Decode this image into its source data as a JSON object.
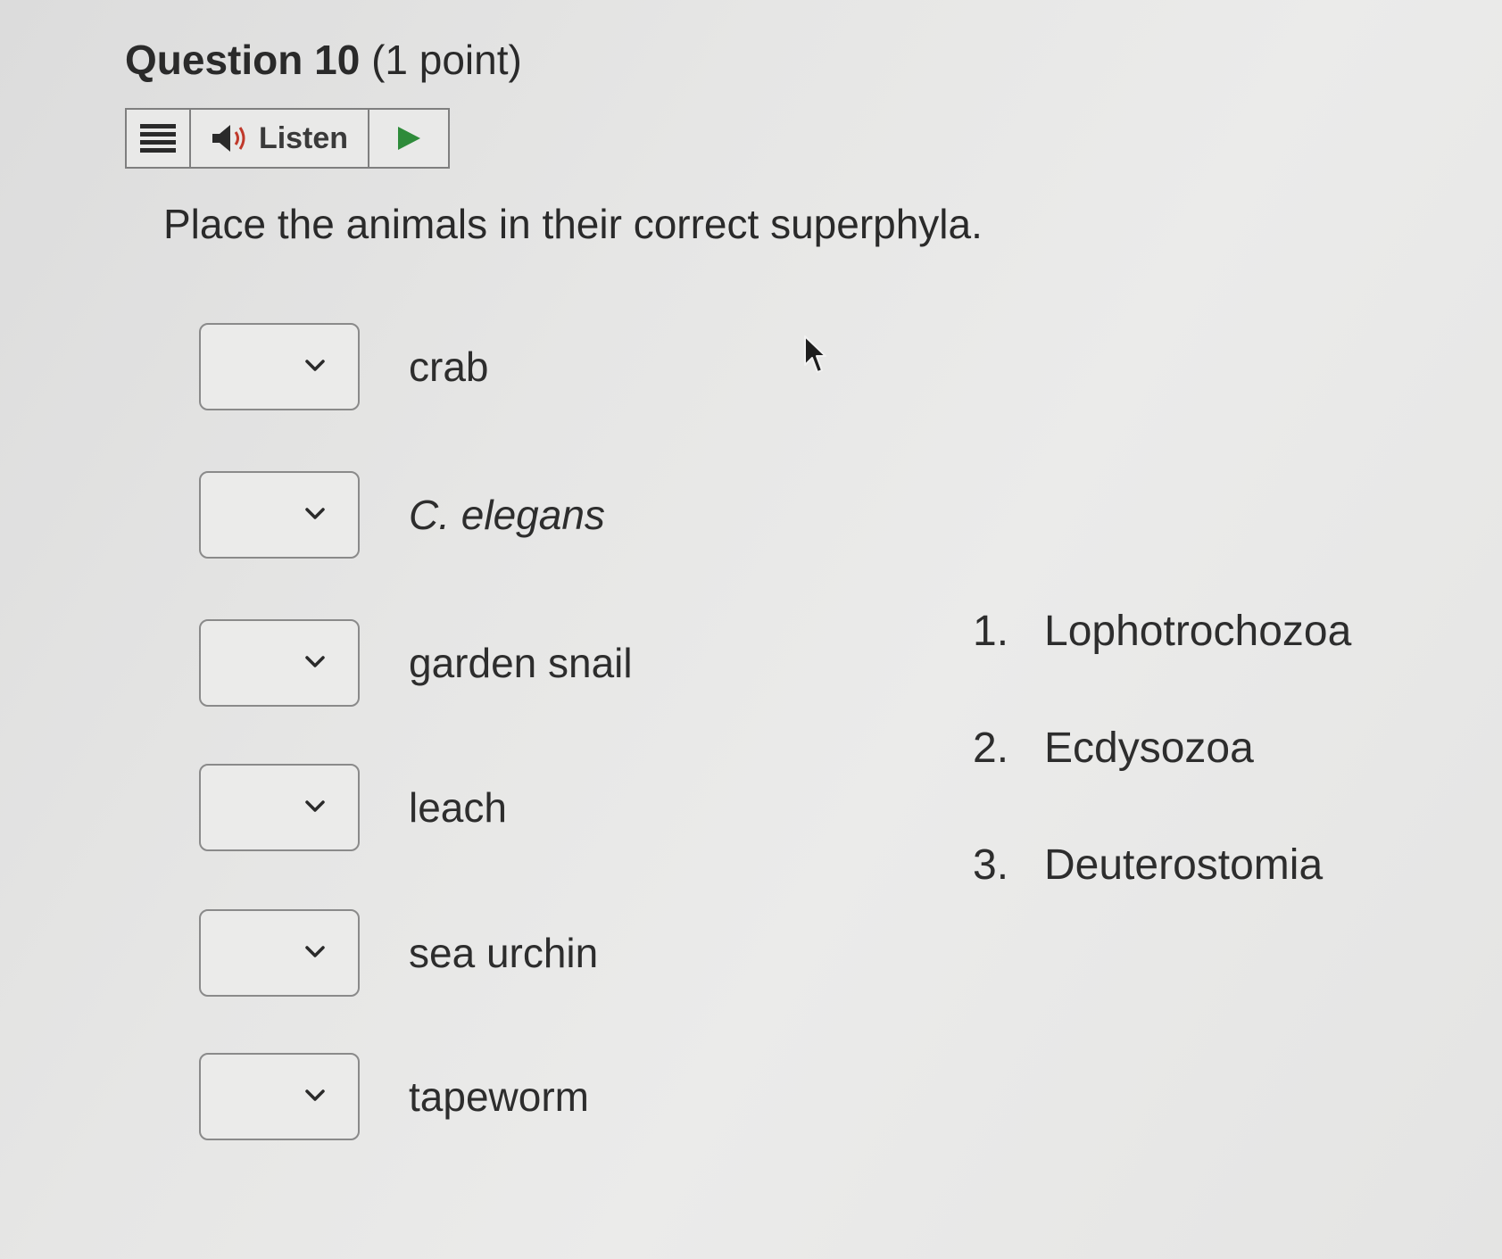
{
  "question": {
    "title": "Question 10",
    "points": "(1 point)",
    "prompt": "Place the animals in their correct superphyla."
  },
  "toolbar": {
    "listen_label": "Listen",
    "menu_icon": "menu-icon",
    "speaker_icon": "speaker-icon",
    "play_icon": "play-icon",
    "play_color": "#2e8b3a"
  },
  "matching": {
    "items": [
      {
        "label": "crab",
        "selected": ""
      },
      {
        "label": "C. elegans",
        "selected": ""
      },
      {
        "label": "garden snail",
        "selected": ""
      },
      {
        "label": "leach",
        "selected": ""
      },
      {
        "label": "sea urchin",
        "selected": ""
      },
      {
        "label": "tapeworm",
        "selected": ""
      }
    ],
    "options": [
      {
        "number": "1.",
        "label": "Lophotrochozoa"
      },
      {
        "number": "2.",
        "label": "Ecdysozoa"
      },
      {
        "number": "3.",
        "label": "Deuterostomia"
      }
    ]
  }
}
